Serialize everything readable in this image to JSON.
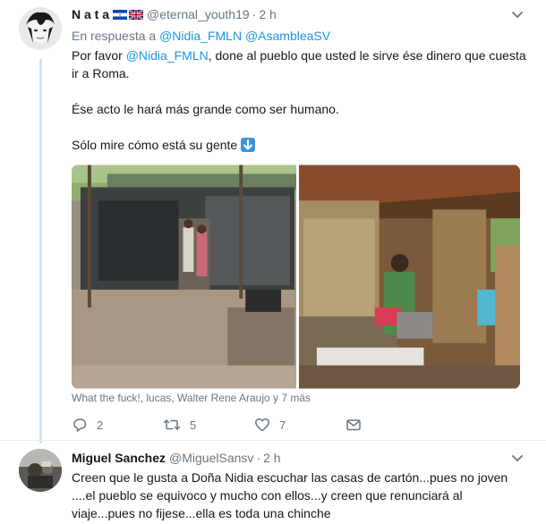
{
  "tweet1": {
    "display_name": "N a t a",
    "handle": "@eternal_youth19",
    "separator": "·",
    "time": "2 h",
    "reply_prefix": "En respuesta a",
    "reply_mentions": "@Nidia_FMLN @AsambleaSV",
    "text_line1_pre": "Por favor ",
    "text_line1_mention": "@Nidia_FMLN",
    "text_line1_post": ", done al pueblo que usted le sirve ése dinero que cuesta ir a Roma.",
    "text_line2": "Ése acto le hará más grande como ser humano.",
    "text_line3": "Sólo mire cómo está su gente",
    "emoji_arrow": "down-arrow-emoji",
    "media_caption": "What the fuck!, lucas, Walter Rene Araujo y 7 más",
    "reply_count": "2",
    "retweet_count": "5",
    "like_count": "7",
    "flags": [
      "el-salvador-flag",
      "uk-flag"
    ]
  },
  "tweet2": {
    "display_name": "Miguel Sanchez",
    "handle": "@MiguelSansv",
    "separator": "·",
    "time": "2 h",
    "text": "Creen que le gusta a Doña Nidia escuchar las casas de cartón...pues no joven ....el pueblo se equivoco y mucho con ellos...y creen que renunciará al viaje...pues no fijese...ella es toda una chinche"
  },
  "colors": {
    "link": "#1b95e0",
    "muted": "#657786",
    "thread_line": "#cfe4f5",
    "divider": "#e6ecf0"
  }
}
